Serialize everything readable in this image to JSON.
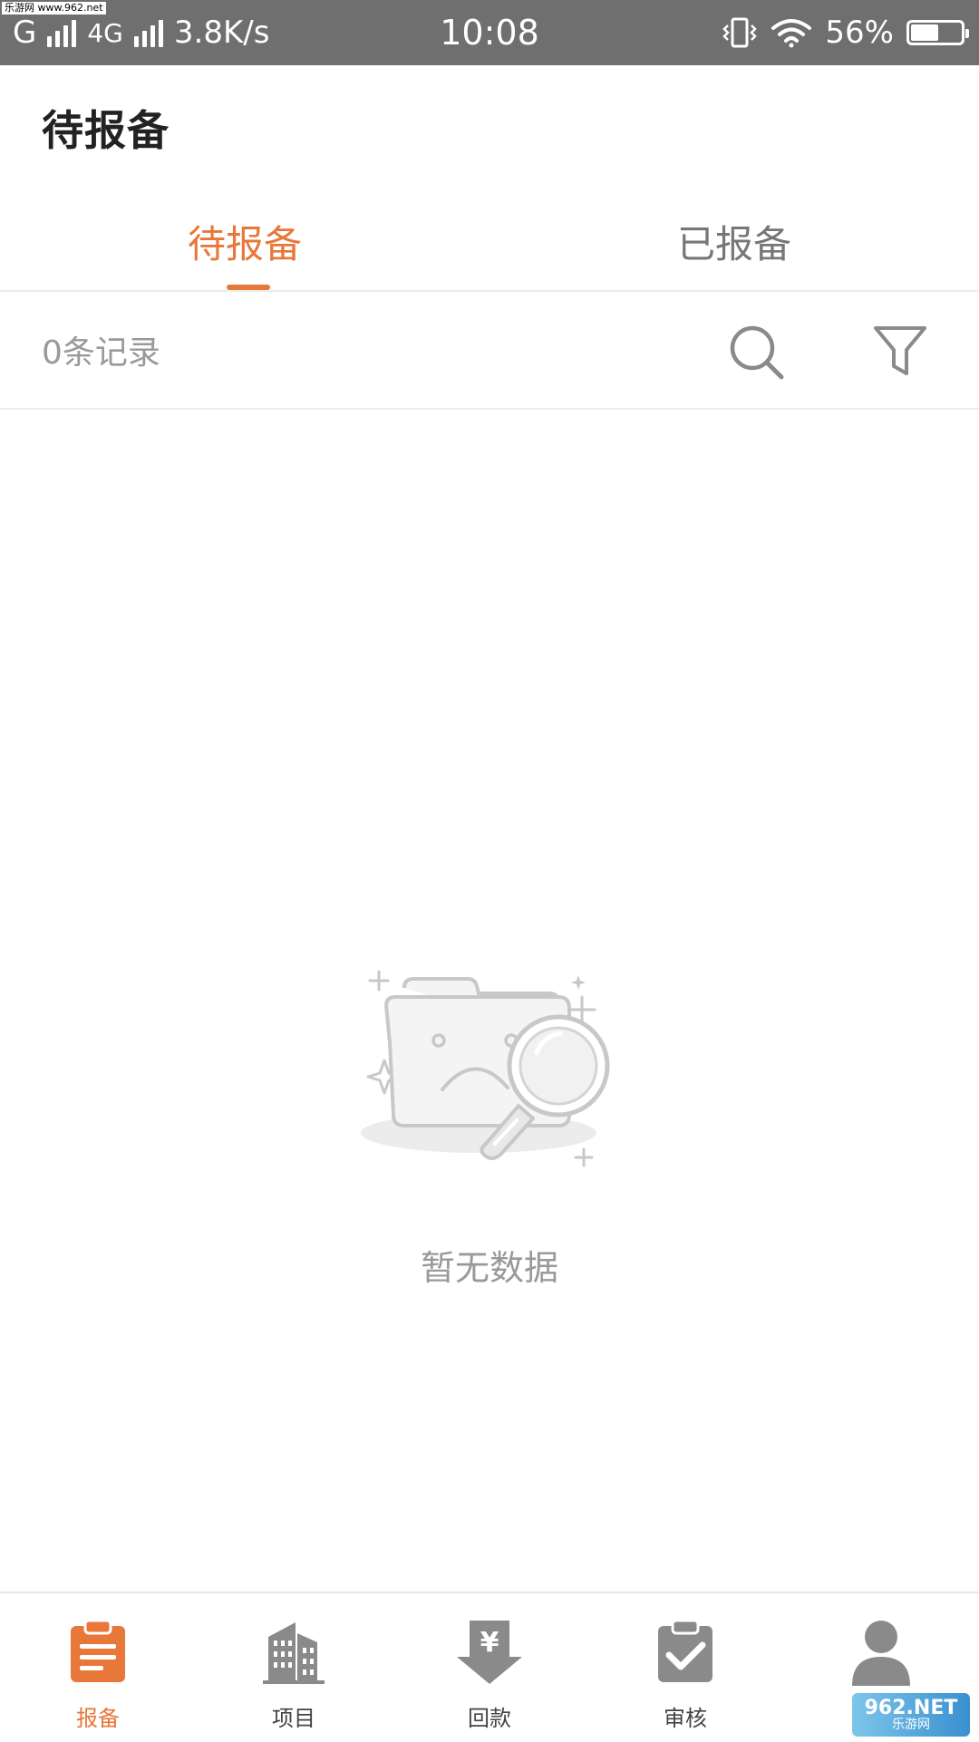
{
  "status_bar": {
    "carrier1": "G",
    "carrier2": "4G",
    "speed": "3.8K/s",
    "time": "10:08",
    "battery": "56%",
    "battery_level": 0.56,
    "watermark": "乐游网 www.962.net"
  },
  "header": {
    "title": "待报备"
  },
  "tabs": [
    {
      "label": "待报备",
      "active": true
    },
    {
      "label": "已报备",
      "active": false
    }
  ],
  "records": {
    "count_label": "0条记录",
    "search_icon": "search-icon",
    "filter_icon": "filter-icon"
  },
  "empty_state": {
    "icon": "empty-folder-magnifier-icon",
    "text": "暂无数据"
  },
  "bottom_nav": [
    {
      "label": "报备",
      "icon": "report-clipboard-icon",
      "active": true
    },
    {
      "label": "项目",
      "icon": "building-icon",
      "active": false
    },
    {
      "label": "回款",
      "icon": "payment-download-icon",
      "active": false
    },
    {
      "label": "审核",
      "icon": "approve-clipboard-icon",
      "active": false
    },
    {
      "label": "",
      "icon": "user-icon",
      "active": false
    }
  ],
  "watermark_bottom": {
    "main": "962.NET",
    "sub": "乐游网"
  },
  "colors": {
    "accent": "#e8773a",
    "status_bar": "#6f6f6f",
    "icon_gray": "#8a8a8a"
  }
}
